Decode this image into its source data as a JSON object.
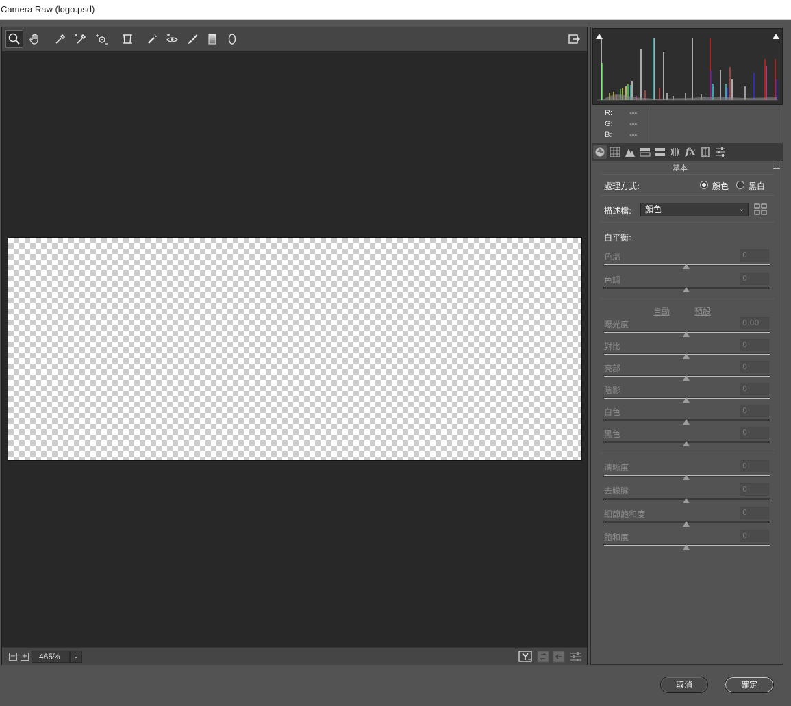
{
  "window": {
    "title": "Camera Raw (logo.psd)"
  },
  "toolbar": {
    "tools": [
      "zoom-tool",
      "hand-tool",
      "white-balance-tool",
      "color-sampler-tool",
      "targeted-adjustment-tool",
      "transform-tool",
      "spot-removal-tool",
      "red-eye-tool",
      "adjustment-brush",
      "graduated-filter",
      "radial-filter"
    ],
    "right_icon": "open-preferences-icon"
  },
  "status": {
    "zoom": "465%"
  },
  "histogram": {
    "r_label": "R:",
    "r_value": "---",
    "g_label": "G:",
    "g_value": "---",
    "b_label": "B:",
    "b_value": "---"
  },
  "panel": {
    "title": "基本",
    "treatment_label": "處理方式:",
    "treatment_color": "顏色",
    "treatment_bw": "黑白",
    "profile_label": "描述檔:",
    "profile_value": "顏色",
    "wb_label": "白平衡:",
    "auto_link": "自動",
    "default_link": "預設",
    "sliders": {
      "temp": {
        "label": "色溫",
        "value": "0"
      },
      "tint": {
        "label": "色調",
        "value": "0"
      },
      "exposure": {
        "label": "曝光度",
        "value": "0.00"
      },
      "contrast": {
        "label": "對比",
        "value": "0"
      },
      "highlights": {
        "label": "亮部",
        "value": "0"
      },
      "shadows": {
        "label": "陰影",
        "value": "0"
      },
      "whites": {
        "label": "白色",
        "value": "0"
      },
      "blacks": {
        "label": "黑色",
        "value": "0"
      },
      "clarity": {
        "label": "清晰度",
        "value": "0"
      },
      "dehaze": {
        "label": "去朦朧",
        "value": "0"
      },
      "vibrance": {
        "label": "細節飽和度",
        "value": "0"
      },
      "saturation": {
        "label": "飽和度",
        "value": "0"
      }
    }
  },
  "buttons": {
    "cancel": "取消",
    "ok": "確定"
  },
  "colors": {
    "background": "#535353",
    "canvas_area": "#282828",
    "toolbar": "#454545"
  }
}
